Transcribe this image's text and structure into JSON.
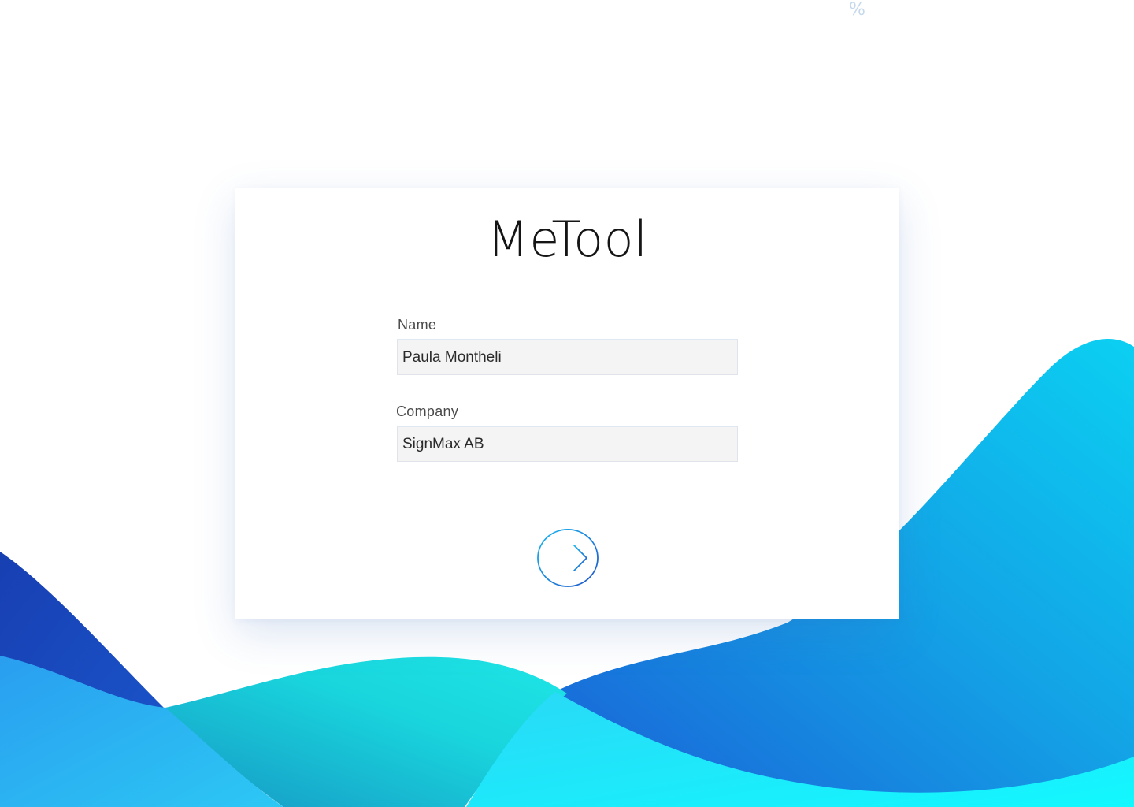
{
  "app": {
    "title": "MeTool"
  },
  "corner_glyph": "%",
  "form": {
    "name": {
      "label": "Name",
      "value": "Paula Montheli"
    },
    "company": {
      "label": "Company",
      "value": "SignMax AB"
    },
    "submit_icon": "arrow-right-circle-icon"
  },
  "colors": {
    "wave_dark_blue": "#1a4fc0",
    "wave_mid_blue": "#1a8fe6",
    "wave_cyan": "#19dbe0",
    "wave_light_cyan": "#2ff0ff",
    "arrow_start": "#19b6f0",
    "arrow_end": "#1f55c8",
    "field_bg": "#f4f4f4"
  }
}
